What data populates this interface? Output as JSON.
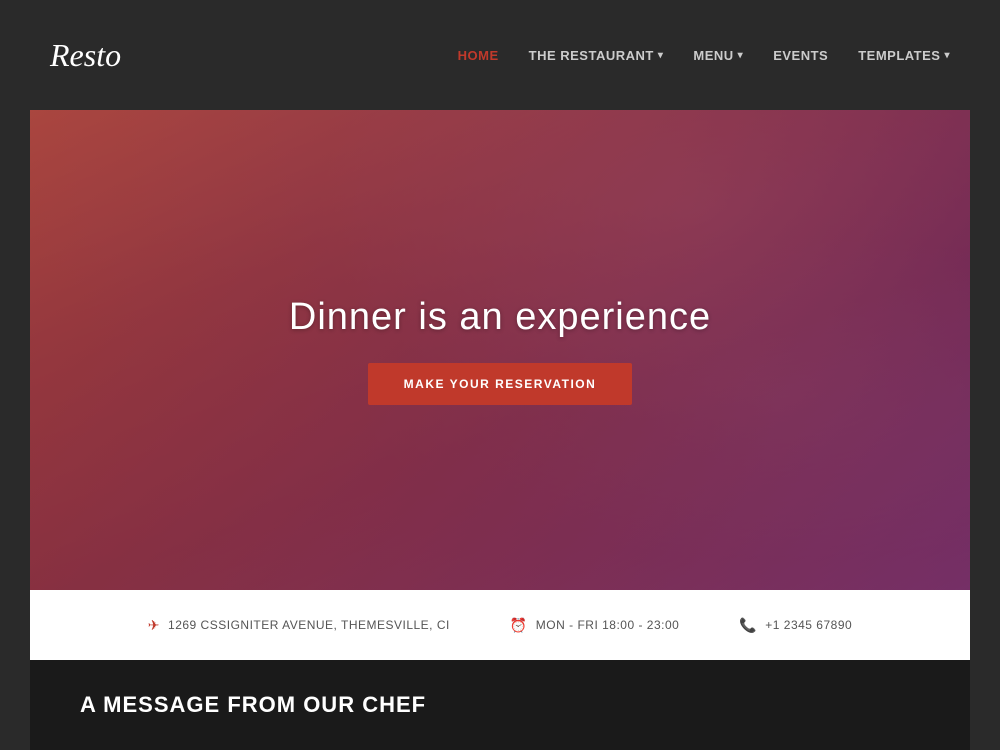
{
  "header": {
    "logo": "Resto",
    "nav": [
      {
        "id": "home",
        "label": "HOME",
        "active": true,
        "hasDropdown": false
      },
      {
        "id": "restaurant",
        "label": "THE RESTAURANT",
        "active": false,
        "hasDropdown": true
      },
      {
        "id": "menu",
        "label": "MENU",
        "active": false,
        "hasDropdown": true
      },
      {
        "id": "events",
        "label": "EVENTS",
        "active": false,
        "hasDropdown": false
      },
      {
        "id": "templates",
        "label": "TEMPLATES",
        "active": false,
        "hasDropdown": true
      }
    ]
  },
  "hero": {
    "title": "Dinner is an experience",
    "cta_label": "MAKE YOUR RESERVATION"
  },
  "info_bar": {
    "items": [
      {
        "id": "address",
        "icon": "📍",
        "text": "1269 CSSIGNITER AVENUE, THEMESVILLE, CI"
      },
      {
        "id": "hours",
        "icon": "🕐",
        "text": "MON - FRI 18:00 - 23:00"
      },
      {
        "id": "phone",
        "icon": "📞",
        "text": "+1 2345 67890"
      }
    ]
  },
  "bottom": {
    "title": "A MESSAGE FROM OUR CHEF"
  }
}
